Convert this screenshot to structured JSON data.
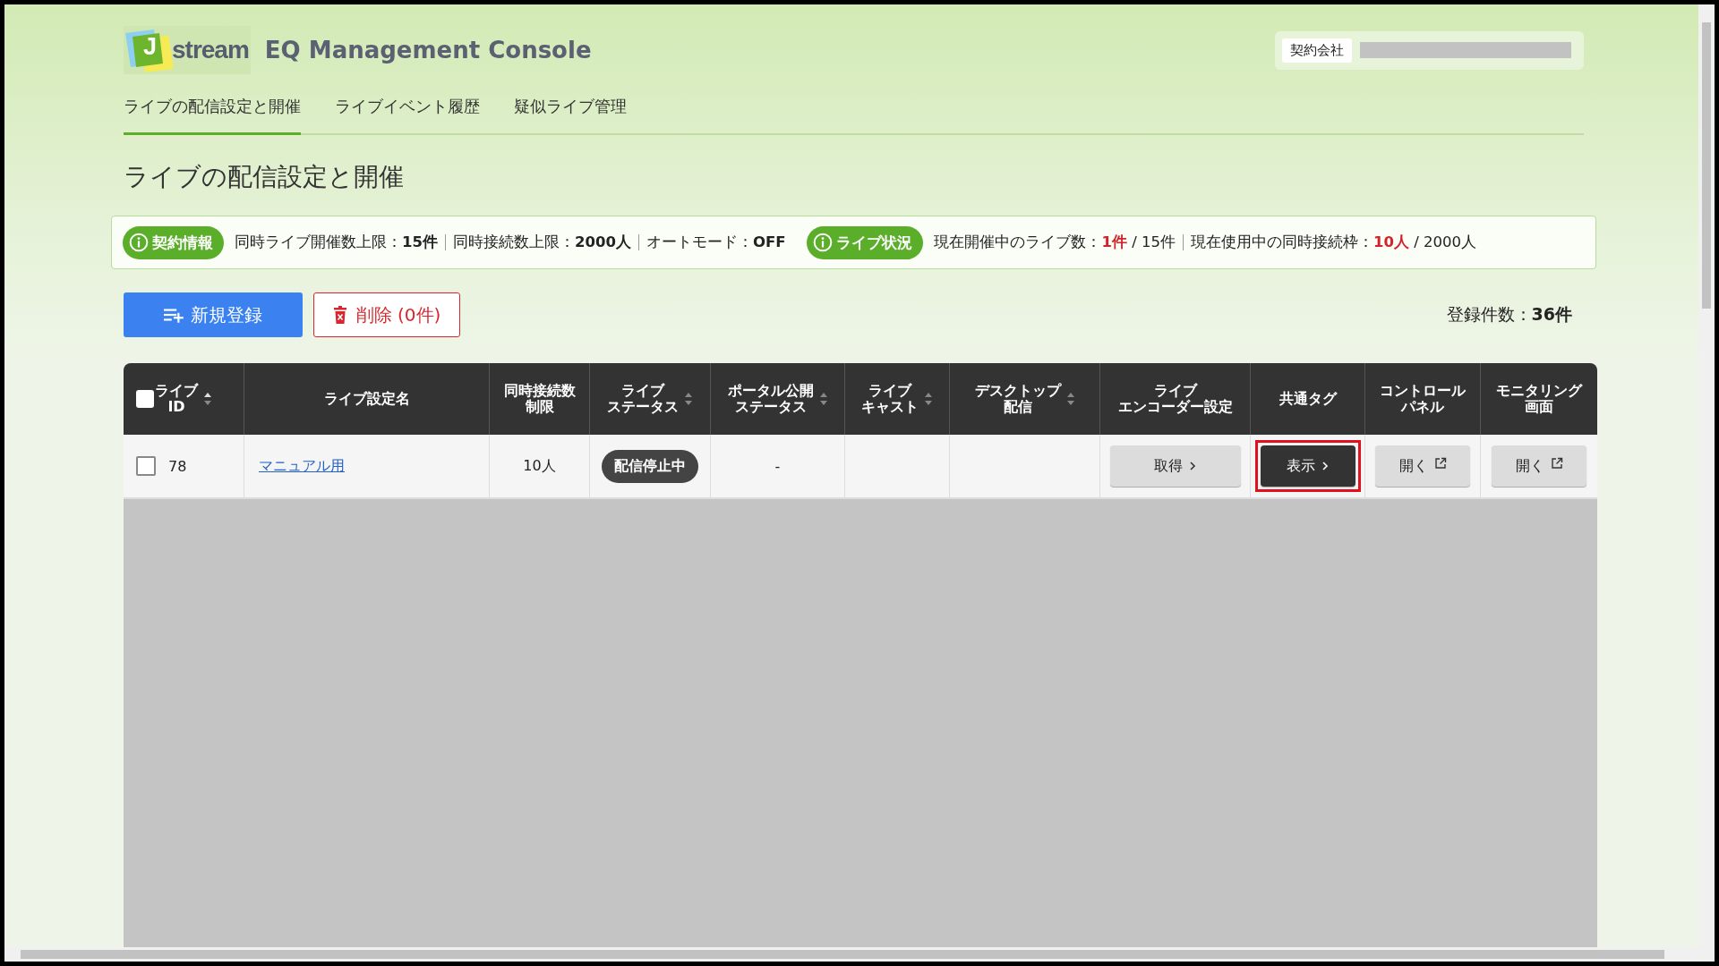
{
  "header": {
    "logo_text": "stream",
    "logo_initial": "J",
    "title": "EQ Management Console",
    "company_label": "契約会社"
  },
  "tabs": [
    {
      "label": "ライブの配信設定と開催",
      "selected": true
    },
    {
      "label": "ライブイベント履歴",
      "selected": false
    },
    {
      "label": "疑似ライブ管理",
      "selected": false
    }
  ],
  "page_title": "ライブの配信設定と開催",
  "contract_info": {
    "badge": "契約情報",
    "items": [
      {
        "label": "同時ライブ開催数上限：",
        "value": "15件"
      },
      {
        "label": "同時接続数上限：",
        "value": "2000人"
      },
      {
        "label": "オートモード：",
        "value": "OFF"
      }
    ]
  },
  "live_status": {
    "badge": "ライブ状況",
    "items": [
      {
        "label": "現在開催中のライブ数：",
        "current": "1件",
        "total": " / 15件"
      },
      {
        "label": "現在使用中の同時接続枠：",
        "current": "10人",
        "total": " / 2000人"
      }
    ]
  },
  "actions": {
    "new_button": "新規登録",
    "delete_button": "削除 (0件)",
    "count_label": "登録件数：",
    "count": "36件"
  },
  "table": {
    "all_checked": false,
    "columns": [
      {
        "lines": [
          "ライブ",
          "ID"
        ],
        "sortable": true,
        "kind": "check"
      },
      {
        "lines": [
          "ライブ設定名"
        ],
        "sortable": false
      },
      {
        "lines": [
          "同時接続数",
          "制限"
        ],
        "sortable": false
      },
      {
        "lines": [
          "ライブ",
          "ステータス"
        ],
        "sortable": true
      },
      {
        "lines": [
          "ポータル公開",
          "ステータス"
        ],
        "sortable": true
      },
      {
        "lines": [
          "ライブ",
          "キャスト"
        ],
        "sortable": true
      },
      {
        "lines": [
          "デスクトップ",
          "配信"
        ],
        "sortable": true
      },
      {
        "lines": [
          "ライブ",
          "エンコーダー設定"
        ],
        "sortable": false
      },
      {
        "lines": [
          "共通タグ"
        ],
        "sortable": false
      },
      {
        "lines": [
          "コントロール",
          "パネル"
        ],
        "sortable": false
      },
      {
        "lines": [
          "モニタリング",
          "画面"
        ],
        "sortable": false
      }
    ],
    "rows": [
      {
        "checked": false,
        "id": "78",
        "name": "マニュアル用",
        "limit": "10人",
        "status": "配信停止中",
        "portal": "-",
        "buttons": [
          {
            "label": "取得",
            "kind": "next",
            "highlighted": false
          },
          {
            "label": "表示",
            "kind": "primary",
            "highlighted": true
          },
          {
            "label": "開く",
            "kind": "external",
            "highlighted": false
          },
          {
            "label": "開く",
            "kind": "external",
            "highlighted": false
          }
        ]
      }
    ]
  }
}
